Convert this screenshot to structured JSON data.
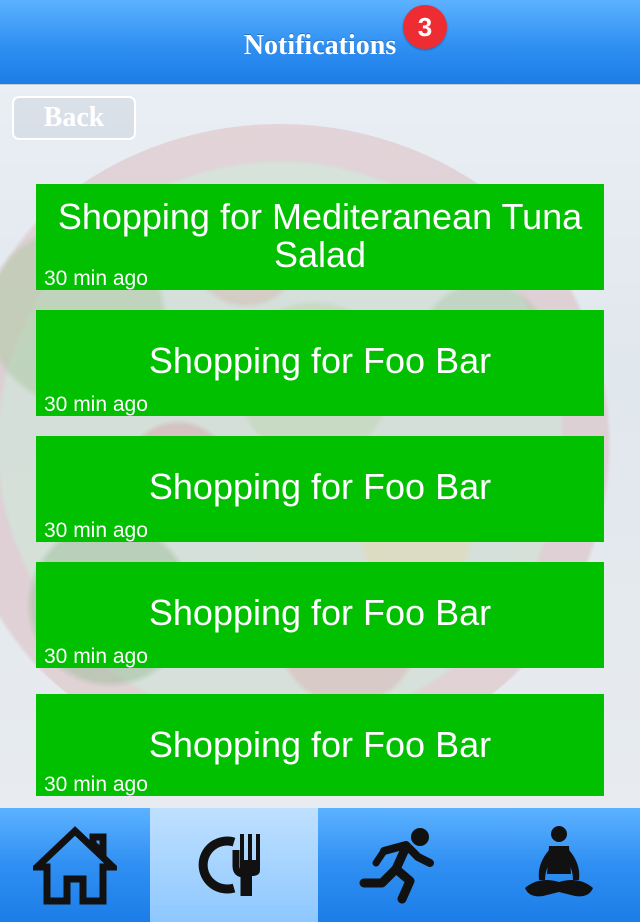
{
  "header": {
    "title": "Notifications",
    "badge_count": "3"
  },
  "back_button": {
    "label": "Back"
  },
  "notifications": [
    {
      "message": "Shopping for Mediteranean Tuna Salad",
      "time": "30 min ago"
    },
    {
      "message": "Shopping for Foo Bar",
      "time": "30 min ago"
    },
    {
      "message": "Shopping for Foo Bar",
      "time": "30 min ago"
    },
    {
      "message": "Shopping for Foo Bar",
      "time": "30 min ago"
    },
    {
      "message": "Shopping for Foo Bar",
      "time": "30 min ago"
    }
  ],
  "tabbar": {
    "tabs": [
      {
        "icon": "home-icon",
        "active": false
      },
      {
        "icon": "dining-icon",
        "active": true
      },
      {
        "icon": "running-icon",
        "active": false
      },
      {
        "icon": "meditation-icon",
        "active": false
      }
    ]
  },
  "colors": {
    "header_blue": "#2f8ff2",
    "card_green": "#00c000",
    "badge_red": "#ee2d33",
    "active_tab": "#8ec8ff"
  }
}
